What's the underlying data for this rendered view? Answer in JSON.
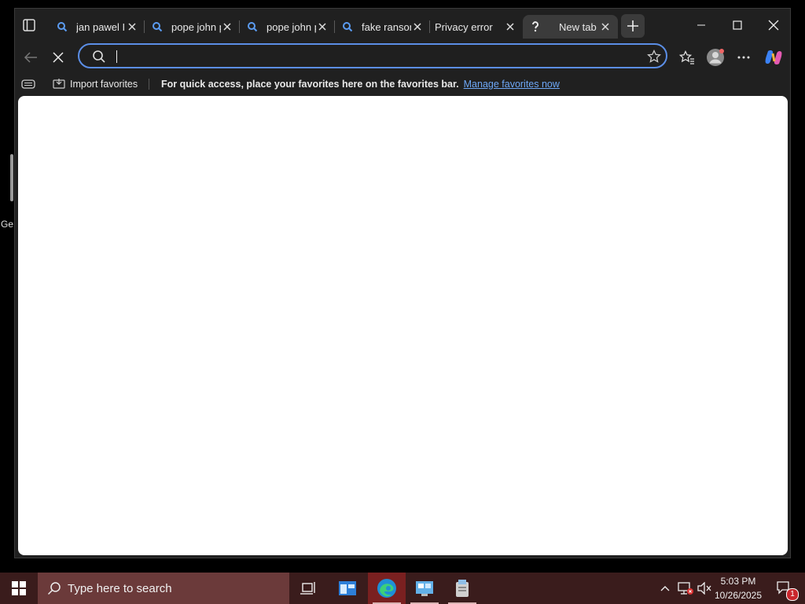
{
  "desktop": {
    "label": "Ge"
  },
  "tabs": [
    {
      "title": "jan pawel II",
      "icon": "search-icon",
      "active": false
    },
    {
      "title": "pope john p",
      "icon": "search-icon",
      "active": false
    },
    {
      "title": "pope john p",
      "icon": "search-icon",
      "active": false
    },
    {
      "title": "fake ranson",
      "icon": "search-icon",
      "active": false
    },
    {
      "title": "Privacy error",
      "icon": "none",
      "active": false
    },
    {
      "title": "New tab",
      "icon": "loading-icon",
      "active": true
    }
  ],
  "omnibox": {
    "value": "",
    "placeholder": ""
  },
  "favorites_bar": {
    "import_label": "Import favorites",
    "message": "For quick access, place your favorites here on the favorites bar.",
    "manage_link": "Manage favorites now"
  },
  "taskbar": {
    "search_placeholder": "Type here to search",
    "time": "5:03 PM",
    "date": "10/26/2025",
    "notification_count": "1"
  },
  "colors": {
    "accent": "#5b8ee6",
    "link": "#6ea8f7",
    "taskbar": "#3a1c1c",
    "taskbar_search": "#6b3a3a"
  }
}
